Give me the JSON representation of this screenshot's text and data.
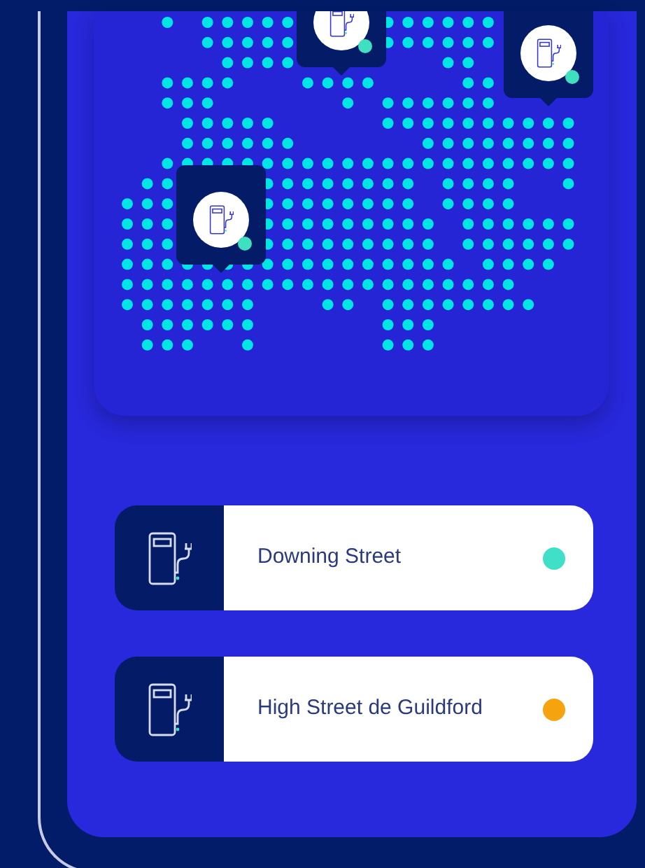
{
  "locations": [
    {
      "name": "Downing Street",
      "color": "#40e0c8"
    },
    {
      "name": "High Street de Guildford",
      "color": "#f5a30f"
    }
  ]
}
